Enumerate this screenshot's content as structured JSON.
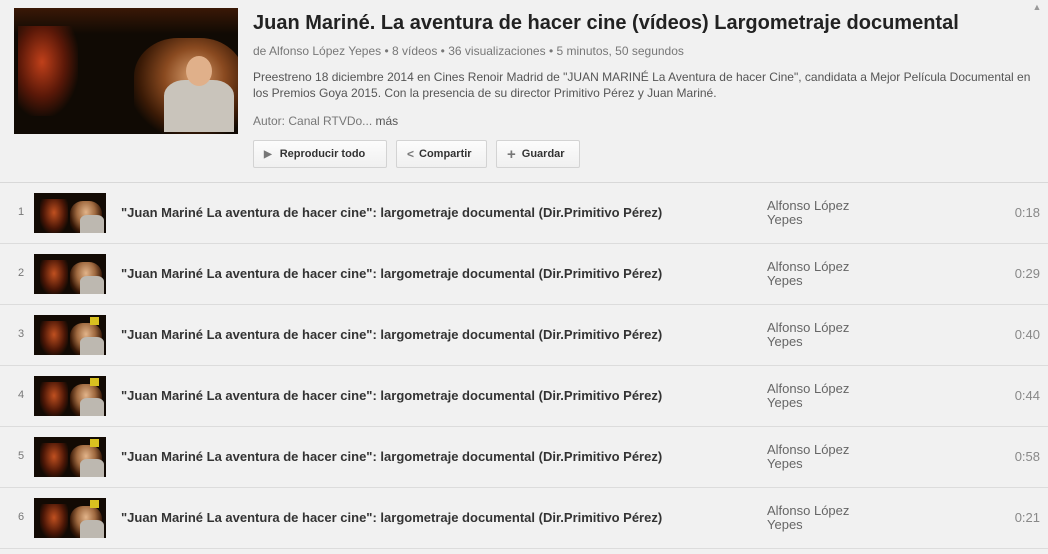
{
  "playlist": {
    "title": "Juan Mariné. La aventura de hacer cine (vídeos) Largometraje documental",
    "meta": "de Alfonso López Yepes • 8 vídeos • 36 visualizaciones • 5 minutos, 50 segundos",
    "description": "Preestreno 18 diciembre 2014 en Cines Renoir Madrid de \"JUAN MARINÉ La Aventura de hacer Cine\", candidata a Mejor Película Documental en los Premios Goya 2015. Con la presencia de su director Primitivo Pérez y Juan Mariné.",
    "author": "Autor: Canal RTVDo...",
    "more": "más"
  },
  "buttons": {
    "play": {
      "label": "Reproducir todo",
      "icon": "play-icon"
    },
    "share": {
      "label": "Compartir",
      "icon": "share-icon"
    },
    "save": {
      "label": "Guardar",
      "icon": "plus-icon"
    }
  },
  "videos": [
    {
      "index": "1",
      "title": "\"Juan Mariné La aventura de hacer cine\": largometraje documental (Dir.Primitivo Pérez)",
      "owner": "Alfonso López Yepes",
      "duration": "0:18"
    },
    {
      "index": "2",
      "title": "\"Juan Mariné La aventura de hacer cine\": largometraje documental (Dir.Primitivo Pérez)",
      "owner": "Alfonso López Yepes",
      "duration": "0:29"
    },
    {
      "index": "3",
      "title": "\"Juan Mariné La aventura de hacer cine\": largometraje documental (Dir.Primitivo Pérez)",
      "owner": "Alfonso López Yepes",
      "duration": "0:40"
    },
    {
      "index": "4",
      "title": "\"Juan Mariné La aventura de hacer cine\": largometraje documental (Dir.Primitivo Pérez)",
      "owner": "Alfonso López Yepes",
      "duration": "0:44"
    },
    {
      "index": "5",
      "title": "\"Juan Mariné La aventura de hacer cine\": largometraje documental (Dir.Primitivo Pérez)",
      "owner": "Alfonso López Yepes",
      "duration": "0:58"
    },
    {
      "index": "6",
      "title": "\"Juan Mariné La aventura de hacer cine\": largometraje documental (Dir.Primitivo Pérez)",
      "owner": "Alfonso López Yepes",
      "duration": "0:21"
    }
  ]
}
